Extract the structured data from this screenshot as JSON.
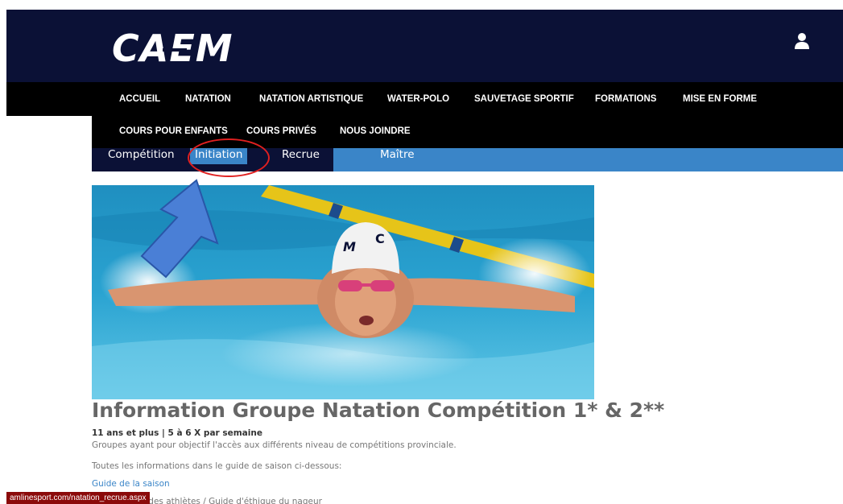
{
  "header": {
    "logo_text": "CAEM",
    "user_icon": "user-icon"
  },
  "nav": {
    "row1": [
      "ACCUEIL",
      "NATATION",
      "NATATION ARTISTIQUE",
      "WATER-POLO",
      "SAUVETAGE SPORTIF",
      "FORMATIONS",
      "MISE EN FORME"
    ],
    "row2": [
      "COURS POUR ENFANTS",
      "COURS PRIVÉS",
      "NOUS JOINDRE"
    ]
  },
  "subnav": {
    "items": [
      "Compétition",
      "Initiation",
      "Recrue",
      "Maître"
    ],
    "active": "Initiation"
  },
  "annotations": {
    "circle_color": "#e02020",
    "arrow_color": "#4a7fd6"
  },
  "hero": {
    "alt": "Nageur en papillon"
  },
  "content": {
    "title": "Information Groupe Natation Compétition 1* & 2**",
    "meta": "11 ans et plus | 5 à 6 X  par semaine",
    "description": "Groupes ayant pour objectif l'accès aux différents niveau de compétitions provinciale.",
    "info": "Toutes les informations dans le guide de saison ci-dessous:",
    "guide_link": "Guide de la saison",
    "partial_link": "Engagement des athlètes / Guide d'éthique du nageur"
  },
  "status_bar": {
    "url": "amlinesport.com/natation_recrue.aspx"
  },
  "colors": {
    "header_bg": "#0b1136",
    "nav_bg": "#000000",
    "subnav_bg": "#3a85c8",
    "link": "#3a85c8"
  }
}
